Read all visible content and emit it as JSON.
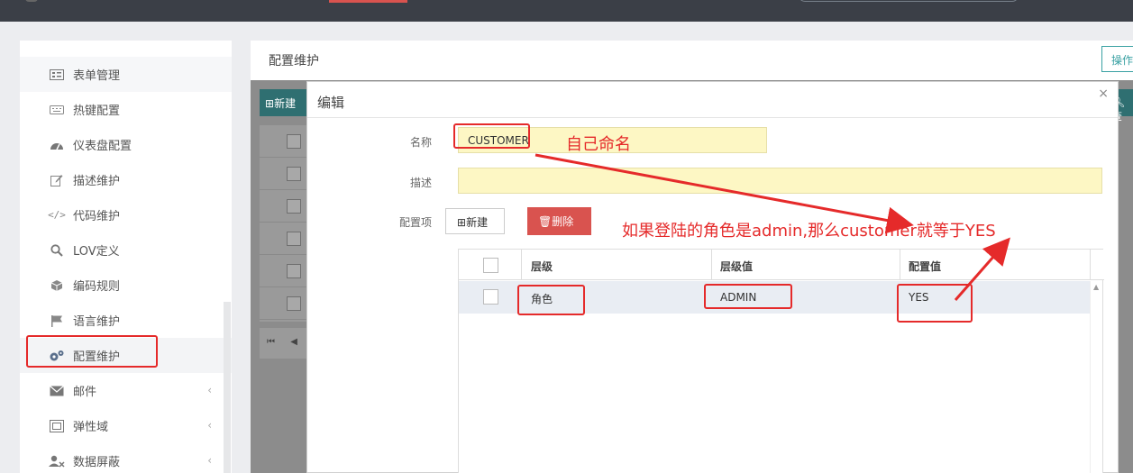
{
  "sidebar": {
    "items": [
      {
        "label": "表单管理",
        "icon": "form-list-icon"
      },
      {
        "label": "热键配置",
        "icon": "keyboard-icon"
      },
      {
        "label": "仪表盘配置",
        "icon": "dashboard-icon"
      },
      {
        "label": "描述维护",
        "icon": "edit-icon"
      },
      {
        "label": "代码维护",
        "icon": "code-icon"
      },
      {
        "label": "LOV定义",
        "icon": "search-icon"
      },
      {
        "label": "编码规则",
        "icon": "cube-icon"
      },
      {
        "label": "语言维护",
        "icon": "flag-icon"
      },
      {
        "label": "配置维护",
        "icon": "gears-icon"
      },
      {
        "label": "邮件",
        "icon": "envelope-icon"
      },
      {
        "label": "弹性域",
        "icon": "frame-icon"
      },
      {
        "label": "数据屏蔽",
        "icon": "user-mask-icon"
      }
    ]
  },
  "content": {
    "title": "配置维护",
    "op_button": "操作",
    "bg_new": "新建",
    "bg_query": "查"
  },
  "modal": {
    "title": "编辑",
    "close": "×",
    "fields": {
      "name_label": "名称",
      "name_value": "CUSTOMER",
      "desc_label": "描述",
      "desc_value": "",
      "config_label": "配置项"
    },
    "buttons": {
      "new": "新建",
      "delete": "删除"
    },
    "grid": {
      "headers": [
        "层级",
        "层级值",
        "配置值"
      ],
      "rows": [
        {
          "level": "角色",
          "level_value": "ADMIN",
          "config_value": "YES"
        }
      ]
    }
  },
  "annotations": {
    "name_note": "自己命名",
    "rule_note": "如果登陆的角色是admin,那么customer就等于YES"
  },
  "colors": {
    "annotation_red": "#e52a2a",
    "teal": "#3aa1a3",
    "danger": "#d9534f",
    "input_yellow": "#fdf7c4"
  }
}
